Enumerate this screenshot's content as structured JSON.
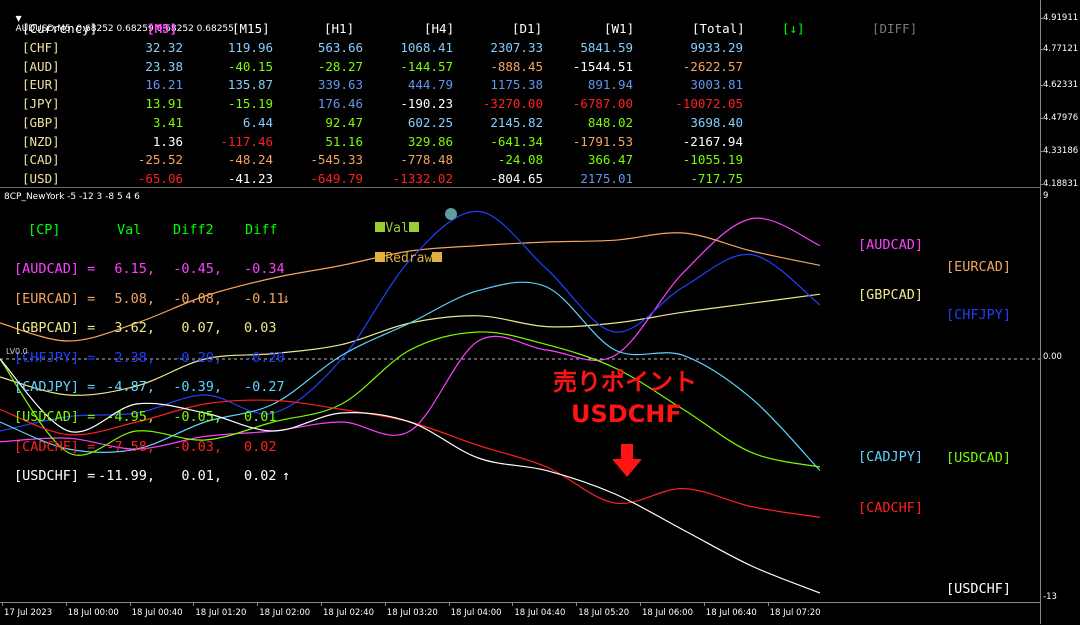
{
  "window": {
    "symbol_line": "AUDUSD,M5  0.68252 0.68259 0.68252 0.68255",
    "indicator_line": "8CP_NewYork -5 -12 3 -8 5 4 6"
  },
  "strength_table": {
    "headers": [
      "[Currency]",
      "[M5]",
      "[M15]",
      "[H1]",
      "[H4]",
      "[D1]",
      "[W1]",
      "[Total]",
      "[↓]",
      "[DIFF]"
    ],
    "header_colors": [
      "#ffffff",
      "#ff40ff",
      "#ffffff",
      "#ffffff",
      "#ffffff",
      "#ffffff",
      "#ffffff",
      "#ffffff",
      "#00ff00",
      "#7a7a7a"
    ],
    "rows": [
      {
        "label": "[CHF]",
        "label_color": "#f0e0a0",
        "values": [
          "32.32",
          "119.96",
          "563.66",
          "1068.41",
          "2307.33",
          "5841.59",
          "9933.29"
        ],
        "colors": [
          "#87cefa",
          "#87cefa",
          "#87cefa",
          "#87cefa",
          "#87cefa",
          "#87cefa",
          "#87cefa"
        ]
      },
      {
        "label": "[AUD]",
        "label_color": "#f0e0a0",
        "values": [
          "23.38",
          "-40.15",
          "-28.27",
          "-144.57",
          "-888.45",
          "-1544.51",
          "-2622.57"
        ],
        "colors": [
          "#87cefa",
          "#7cfc00",
          "#7cfc00",
          "#7cfc00",
          "#f4a460",
          "#ffffff",
          "#f4a460"
        ]
      },
      {
        "label": "[EUR]",
        "label_color": "#f0e0a0",
        "values": [
          "16.21",
          "135.87",
          "339.63",
          "444.79",
          "1175.38",
          "891.94",
          "3003.81"
        ],
        "colors": [
          "#6495ed",
          "#87cefa",
          "#6495ed",
          "#6495ed",
          "#6495ed",
          "#6495ed",
          "#6495ed"
        ]
      },
      {
        "label": "[JPY]",
        "label_color": "#f0e0a0",
        "values": [
          "13.91",
          "-15.19",
          "176.46",
          "-190.23",
          "-3270.00",
          "-6787.00",
          "-10072.05"
        ],
        "colors": [
          "#7cfc00",
          "#7cfc00",
          "#6495ed",
          "#ffffff",
          "#ff2020",
          "#ff2020",
          "#ff2020"
        ]
      },
      {
        "label": "[GBP]",
        "label_color": "#f0e0a0",
        "values": [
          "3.41",
          "6.44",
          "92.47",
          "602.25",
          "2145.82",
          "848.02",
          "3698.40"
        ],
        "colors": [
          "#7cfc00",
          "#87cefa",
          "#7cfc00",
          "#87cefa",
          "#87cefa",
          "#7cfc00",
          "#87cefa"
        ]
      },
      {
        "label": "[NZD]",
        "label_color": "#f0e0a0",
        "values": [
          "1.36",
          "-117.46",
          "51.16",
          "329.86",
          "-641.34",
          "-1791.53",
          "-2167.94"
        ],
        "colors": [
          "#ffffff",
          "#ff2020",
          "#7cfc00",
          "#7cfc00",
          "#7cfc00",
          "#f4a460",
          "#ffffff"
        ]
      },
      {
        "label": "[CAD]",
        "label_color": "#f0e0a0",
        "values": [
          "-25.52",
          "-48.24",
          "-545.33",
          "-778.48",
          "-24.08",
          "366.47",
          "-1055.19"
        ],
        "colors": [
          "#f4a460",
          "#f4a460",
          "#f4a460",
          "#f4a460",
          "#7cfc00",
          "#7cfc00",
          "#7cfc00"
        ]
      },
      {
        "label": "[USD]",
        "label_color": "#f0e0a0",
        "values": [
          "-65.06",
          "-41.23",
          "-649.79",
          "-1332.02",
          "-804.65",
          "2175.01",
          "-717.75"
        ],
        "colors": [
          "#ff2020",
          "#ffffff",
          "#ff2020",
          "#ff2020",
          "#ffffff",
          "#6495ed",
          "#7cfc00"
        ]
      }
    ]
  },
  "top_axis_prices": [
    "4.91911",
    "4.77121",
    "4.62331",
    "4.47976",
    "4.33186",
    "4.18831"
  ],
  "bottom_axis": [
    "9",
    "0.00",
    "-13"
  ],
  "time_axis": [
    "17 Jul 2023",
    "18 Jul 00:00",
    "18 Jul 00:40",
    "18 Jul 01:20",
    "18 Jul 02:00",
    "18 Jul 02:40",
    "18 Jul 03:20",
    "18 Jul 04:00",
    "18 Jul 04:40",
    "18 Jul 05:20",
    "18 Jul 06:00",
    "18 Jul 06:40",
    "18 Jul 07:20"
  ],
  "legend": {
    "val": "Val",
    "redraw": "Redraw",
    "val_color": "#9acd32",
    "redraw_color": "#e0b040",
    "circle_color": "#5f9ea0"
  },
  "pairs_table": {
    "headers": [
      "[CP]",
      "Val",
      "Diff2",
      "Diff"
    ],
    "header_color": "#00ff00",
    "rows": [
      {
        "name": "[AUDCAD] =",
        "val": "6.15,",
        "diff2": "-0.45,",
        "diff": "-0.34",
        "arrow": "",
        "color": "#ff40ff"
      },
      {
        "name": "[EURCAD] =",
        "val": "5.08,",
        "diff2": "-0.08,",
        "diff": "-0.11",
        "arrow": "↓",
        "color": "#f4a460"
      },
      {
        "name": "[GBPCAD] =",
        "val": "3.62,",
        "diff2": "0.07,",
        "diff": "0.03",
        "arrow": "",
        "color": "#f0e68c"
      },
      {
        "name": "[CHFJPY] =",
        "val": "2.38,",
        "diff2": "-0.20,",
        "diff": "-0.20",
        "arrow": "",
        "color": "#2040ff"
      },
      {
        "name": "[CADJPY] =",
        "val": "-4.87,",
        "diff2": "-0.39,",
        "diff": "-0.27",
        "arrow": "",
        "color": "#5fd3ff"
      },
      {
        "name": "[USDCAD] =",
        "val": "-4.95,",
        "diff2": "-0.05,",
        "diff": "0.01",
        "arrow": "",
        "color": "#7cfc00"
      },
      {
        "name": "[CADCHF] =",
        "val": "-7.58,",
        "diff2": "-0.03,",
        "diff": "0.02",
        "arrow": "",
        "color": "#ff2020"
      },
      {
        "name": "[USDCHF] =",
        "val": "-11.99,",
        "diff2": "0.01,",
        "diff": "0.02",
        "arrow": "↑",
        "color": "#ffffff"
      }
    ]
  },
  "series_labels": [
    {
      "name": "[AUDCAD]",
      "color": "#ff40ff"
    },
    {
      "name": "[EURCAD]",
      "color": "#f4a460"
    },
    {
      "name": "[GBPCAD]",
      "color": "#f0e68c"
    },
    {
      "name": "[CHFJPY]",
      "color": "#2040ff"
    },
    {
      "name": "[CADJPY]",
      "color": "#5fd3ff"
    },
    {
      "name": "[USDCAD]",
      "color": "#7cfc00"
    },
    {
      "name": "[CADCHF]",
      "color": "#ff2020"
    },
    {
      "name": "[USDCHF]",
      "color": "#ffffff"
    }
  ],
  "zero_line_label": "LV0.0",
  "annotation": {
    "jp": "売りポイント",
    "symbol": "USDCHF",
    "color": "#ff1414"
  },
  "chart_data": {
    "type": "line",
    "ylim": [
      -13,
      9
    ],
    "x": [
      "17 Jul 2023",
      "18 Jul 00:00",
      "18 Jul 00:40",
      "18 Jul 01:20",
      "18 Jul 02:00",
      "18 Jul 02:40",
      "18 Jul 03:20",
      "18 Jul 04:00",
      "18 Jul 04:40",
      "18 Jul 05:20",
      "18 Jul 06:00",
      "18 Jul 06:40",
      "18 Jul 07:20"
    ],
    "series": [
      {
        "name": "[AUDCAD]",
        "color": "#ff40ff",
        "values": [
          -4.6,
          -4.4,
          -5.0,
          -4.3,
          -4.0,
          -3.5,
          -4.0,
          1.0,
          0.5,
          0.2,
          4.8,
          7.8,
          6.3
        ]
      },
      {
        "name": "[EURCAD]",
        "color": "#f4a460",
        "values": [
          2.0,
          1.0,
          2.0,
          3.5,
          4.5,
          5.2,
          6.0,
          6.3,
          6.5,
          6.6,
          7.0,
          6.0,
          5.2
        ]
      },
      {
        "name": "[GBPCAD]",
        "color": "#f0e68c",
        "values": [
          -1.0,
          -2.0,
          -1.5,
          0.0,
          0.3,
          0.8,
          2.0,
          2.4,
          1.8,
          2.0,
          2.6,
          3.1,
          3.6
        ]
      },
      {
        "name": "[CHFJPY]",
        "color": "#2040ff",
        "values": [
          -4.0,
          -3.2,
          -3.0,
          -2.0,
          -3.0,
          0.0,
          5.5,
          8.2,
          5.0,
          1.5,
          4.0,
          5.8,
          3.0
        ]
      },
      {
        "name": "[CADJPY]",
        "color": "#5fd3ff",
        "values": [
          -3.5,
          -5.0,
          -5.0,
          -3.5,
          -2.5,
          0.2,
          2.0,
          3.8,
          4.0,
          0.5,
          0.2,
          -2.2,
          -6.2
        ]
      },
      {
        "name": "[USDCAD]",
        "color": "#7cfc00",
        "values": [
          0.0,
          -5.2,
          -4.0,
          -4.5,
          -3.5,
          -2.5,
          0.5,
          1.5,
          0.8,
          -0.5,
          -2.8,
          -5.2,
          -6.0
        ]
      },
      {
        "name": "[CADCHF]",
        "color": "#ff2020",
        "values": [
          -2.8,
          -4.2,
          -3.5,
          -2.5,
          -2.3,
          -2.8,
          -3.5,
          -4.8,
          -6.0,
          -8.0,
          -7.2,
          -8.2,
          -8.8
        ]
      },
      {
        "name": "[USDCHF]",
        "color": "#ffffff",
        "values": [
          0.0,
          -4.0,
          -2.5,
          -3.0,
          -4.0,
          -3.0,
          -3.5,
          -5.5,
          -6.2,
          -7.5,
          -9.5,
          -11.5,
          -13.0
        ]
      }
    ]
  }
}
